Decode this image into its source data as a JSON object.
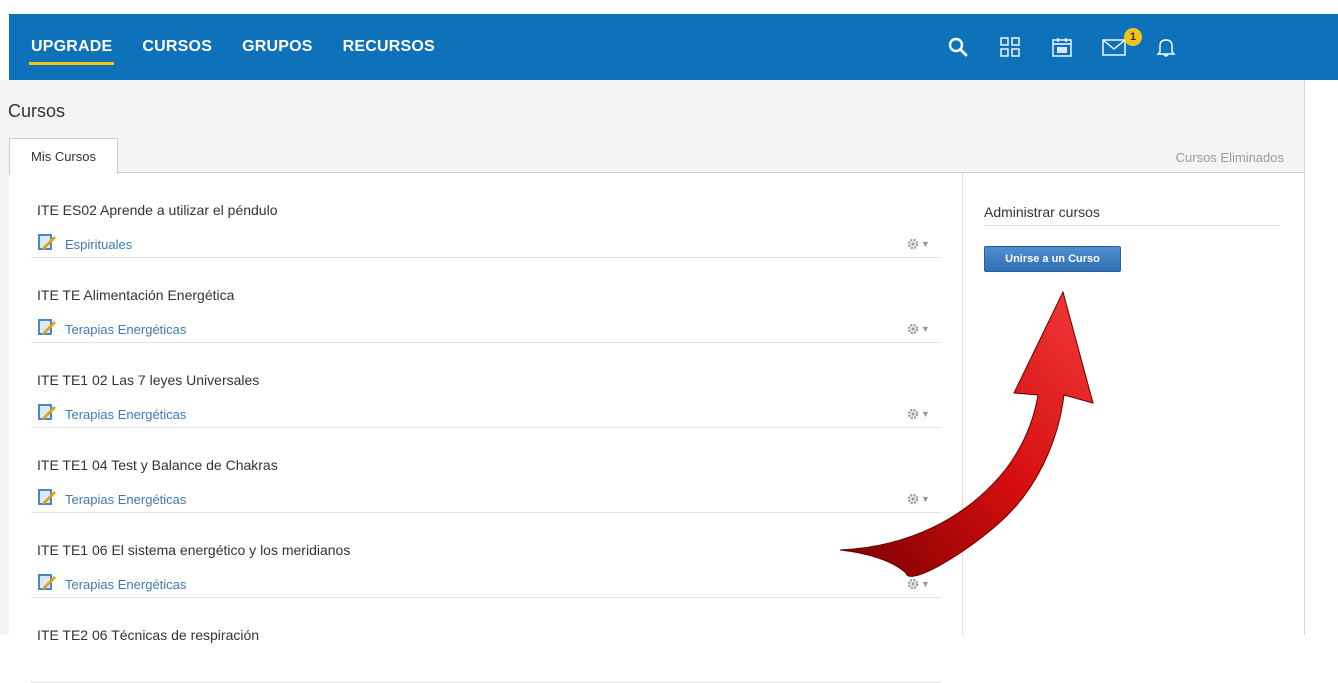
{
  "nav": {
    "items": [
      {
        "label": "UPGRADE",
        "active": true
      },
      {
        "label": "CURSOS",
        "active": false
      },
      {
        "label": "GRUPOS",
        "active": false
      },
      {
        "label": "RECURSOS",
        "active": false
      }
    ],
    "icons": [
      "search-icon",
      "grid-icon",
      "calendar-icon",
      "mail-icon",
      "bell-icon"
    ],
    "mail_badge": "1"
  },
  "page": {
    "title": "Cursos",
    "tab_active": "Mis Cursos",
    "tab_right": "Cursos Eliminados"
  },
  "courses": [
    {
      "title": "ITE ES02 Aprende a utilizar el péndulo",
      "category": "Espirituales"
    },
    {
      "title": "ITE TE Alimentación Energética",
      "category": "Terapias Energéticas"
    },
    {
      "title": "ITE TE1 02 Las 7 leyes Universales",
      "category": "Terapias Energéticas"
    },
    {
      "title": "ITE TE1 04 Test y Balance de Chakras",
      "category": "Terapias Energéticas"
    },
    {
      "title": "ITE TE1 06 El sistema energético y los meridianos",
      "category": "Terapias Energéticas"
    },
    {
      "title": "ITE TE2 06 Técnicas de respiración",
      "category": ""
    }
  ],
  "sidebar": {
    "title": "Administrar cursos",
    "join_button": "Unirse a un Curso"
  },
  "colors": {
    "topbar": "#0d72b9",
    "active_underline": "#f1c40f",
    "badge": "#f2c21a",
    "link": "#3e7ab8",
    "arrow": "#d40d0d"
  }
}
